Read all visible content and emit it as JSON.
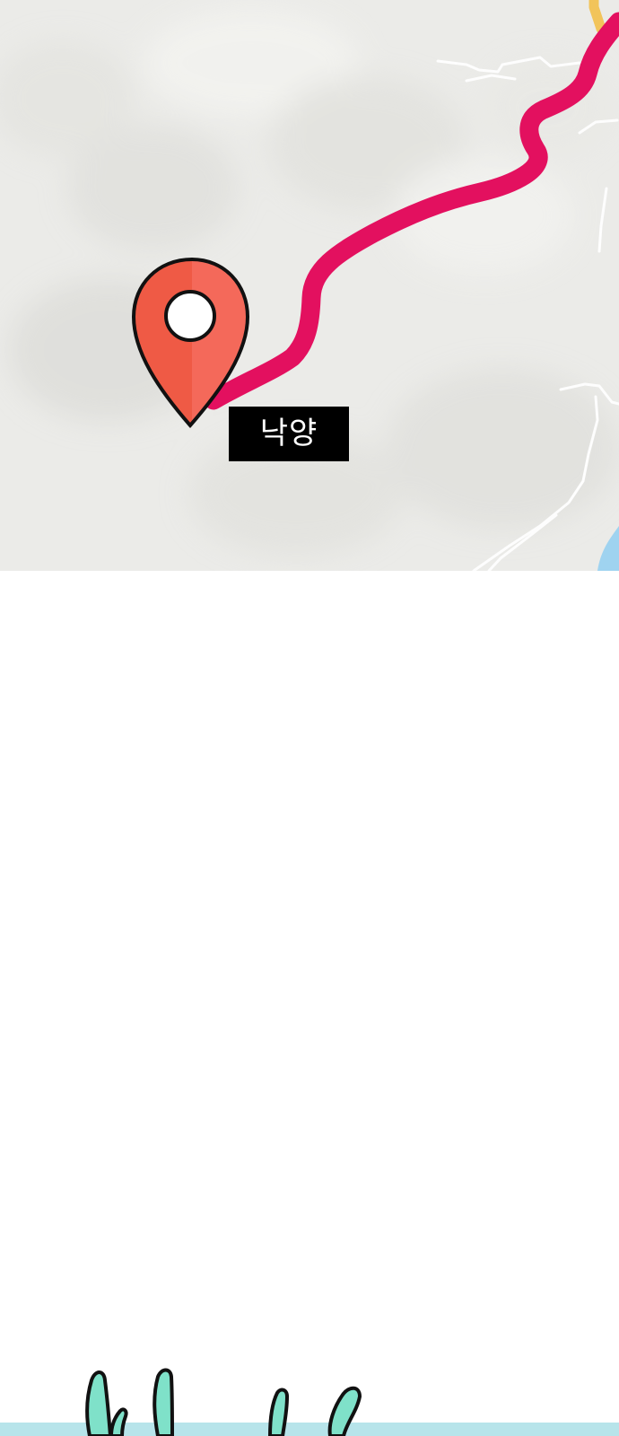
{
  "map": {
    "location_label": "낙양",
    "route_color": "#e3105f",
    "pin_color": "#ef5a45",
    "background_color": "#ebebe8",
    "water_color": "#9fd3f0",
    "highway_color": "#f2c45a"
  },
  "bottom_scene": {
    "ground_color": "#b7e4ea",
    "plant_color": "#7fe1c9",
    "outline_color": "#111111"
  },
  "icons": {
    "pin": "map-pin-icon"
  }
}
